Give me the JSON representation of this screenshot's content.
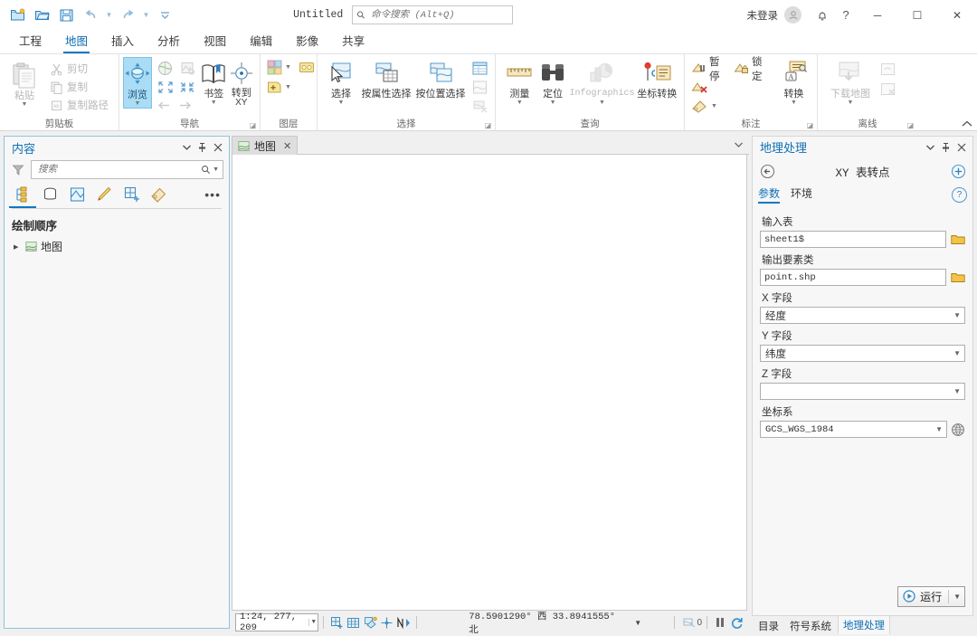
{
  "titlebar": {
    "app_title": "Untitled",
    "search_placeholder": "命令搜索 (Alt+Q)",
    "signin_label": "未登录",
    "qat": [
      {
        "name": "new-project-icon",
        "tooltip": "新建工程"
      },
      {
        "name": "open-project-icon",
        "tooltip": "打开工程"
      },
      {
        "name": "save-project-icon",
        "tooltip": "保存工程"
      },
      {
        "name": "undo-icon",
        "tooltip": "撤销"
      },
      {
        "name": "redo-icon",
        "tooltip": "重做"
      },
      {
        "name": "customize-qat-icon",
        "tooltip": "自定义快速访问工具栏"
      }
    ],
    "window_buttons": {
      "minimize": "─",
      "maximize": "☐",
      "close": "✕"
    }
  },
  "ribbon": {
    "tabs": [
      {
        "label": "工程",
        "active": false
      },
      {
        "label": "地图",
        "active": true
      },
      {
        "label": "插入",
        "active": false
      },
      {
        "label": "分析",
        "active": false
      },
      {
        "label": "视图",
        "active": false
      },
      {
        "label": "编辑",
        "active": false
      },
      {
        "label": "影像",
        "active": false
      },
      {
        "label": "共享",
        "active": false
      }
    ],
    "groups": [
      {
        "label": "剪贴板",
        "big": [
          {
            "label": "粘贴",
            "icon": "paste-icon",
            "dropdown": true
          }
        ],
        "small": [
          {
            "label": "剪切",
            "icon": "cut-icon",
            "disabled": true
          },
          {
            "label": "复制",
            "icon": "copy-icon",
            "disabled": true
          },
          {
            "label": "复制路径",
            "icon": "copy-path-icon",
            "disabled": true
          }
        ]
      },
      {
        "label": "导航",
        "big": [
          {
            "label": "浏览",
            "icon": "explore-icon",
            "selected": true,
            "dropdown": true
          },
          {
            "label": "书签",
            "icon": "bookmarks-icon",
            "dropdown": true
          },
          {
            "label": "转到",
            "label2": "XY",
            "icon": "goto-xy-icon"
          }
        ],
        "mini": [
          {
            "icon": "full-extent-icon"
          },
          {
            "icon": "fixed-zoom-in-icon"
          },
          {
            "icon": "fixed-zoom-out-icon"
          },
          {
            "icon": "previous-extent-icon"
          },
          {
            "icon": "next-extent-icon"
          }
        ],
        "dialog_launcher": true
      },
      {
        "label": "图层",
        "small": [
          {
            "icon": "basemap-icon",
            "dropdown": true
          },
          {
            "icon": "add-preset-icon"
          },
          {
            "icon": "add-data-icon",
            "dropdown": true
          }
        ]
      },
      {
        "label": "选择",
        "big": [
          {
            "label": "选择",
            "icon": "select-icon",
            "dropdown": true
          },
          {
            "label": "按属性选择",
            "icon": "select-by-attributes-icon"
          },
          {
            "label": "按位置选择",
            "icon": "select-by-location-icon"
          }
        ],
        "mini": [
          {
            "icon": "attribute-table-icon"
          },
          {
            "icon": "zoom-to-selection-icon",
            "disabled": true
          },
          {
            "icon": "clear-selection-icon",
            "disabled": true
          }
        ],
        "dialog_launcher": true
      },
      {
        "label": "查询",
        "big": [
          {
            "label": "测量",
            "icon": "measure-icon",
            "dropdown": true
          },
          {
            "label": "定位",
            "icon": "locate-icon",
            "dropdown": true
          },
          {
            "label": "Infographics",
            "icon": "infographics-icon",
            "dropdown": true,
            "disabled": true
          },
          {
            "label": "坐标转换",
            "icon": "convert-coordinates-icon"
          }
        ]
      },
      {
        "label": "标注",
        "small": [
          {
            "label": "暂停",
            "icon": "pause-labeling-icon"
          },
          {
            "label": "锁定",
            "icon": "lock-labeling-icon"
          },
          {
            "icon": "clear-labeling-icon"
          },
          {
            "icon": "label-icon",
            "dropdown": true
          }
        ],
        "big": [
          {
            "label": "转换",
            "icon": "convert-labels-icon",
            "dropdown": true
          }
        ],
        "dialog_launcher": true
      },
      {
        "label": "离线",
        "big": [
          {
            "label": "下载地图",
            "icon": "download-map-icon",
            "dropdown": true,
            "disabled": true
          }
        ],
        "mini": [
          {
            "icon": "sync-icon",
            "disabled": true
          },
          {
            "icon": "manage-replica-icon",
            "disabled": true
          }
        ],
        "dialog_launcher": true
      }
    ]
  },
  "contents": {
    "title": "内容",
    "search_placeholder": "搜索",
    "tabs": [
      {
        "name": "drawing-order-tab",
        "icon": "drawing-order-icon",
        "active": true
      },
      {
        "name": "data-source-tab",
        "icon": "data-source-icon",
        "active": false
      },
      {
        "name": "selection-tab",
        "icon": "selection-icon",
        "active": false
      },
      {
        "name": "editing-tab",
        "icon": "editing-icon",
        "active": false
      },
      {
        "name": "snapping-tab",
        "icon": "snapping-icon",
        "active": false
      },
      {
        "name": "labeling-tab",
        "icon": "labeling-icon",
        "active": false
      }
    ],
    "section_title": "绘制顺序",
    "items": [
      {
        "label": "地图",
        "icon": "map-icon",
        "expanded": true,
        "checked": true
      }
    ]
  },
  "mapview": {
    "tabs": [
      {
        "label": "地图",
        "icon": "map-icon",
        "active": true,
        "close": "✕"
      }
    ]
  },
  "status": {
    "scale": "1:24, 277, 209",
    "coordinates": "78.5901290° 西 33.8941555° 北",
    "selected_count": "0",
    "icons": [
      {
        "name": "grid-snap-icon"
      },
      {
        "name": "grid-icon"
      },
      {
        "name": "selection-tools-icon"
      },
      {
        "name": "crosshair-icon"
      },
      {
        "name": "north-arrow-icon"
      },
      {
        "name": "selection-count-icon"
      },
      {
        "name": "pause-drawing-icon"
      },
      {
        "name": "refresh-icon"
      }
    ]
  },
  "geoprocessing": {
    "title": "地理处理",
    "tool_name": "XY 表转点",
    "tabs": [
      {
        "label": "参数",
        "active": true
      },
      {
        "label": "环境",
        "active": false
      }
    ],
    "fields": [
      {
        "label": "输入表",
        "type": "text",
        "value": "sheet1$",
        "browse": true
      },
      {
        "label": "输出要素类",
        "type": "text",
        "value": "point.shp",
        "browse": true
      },
      {
        "label": "X 字段",
        "type": "combo",
        "value": "经度"
      },
      {
        "label": "Y 字段",
        "type": "combo",
        "value": "纬度"
      },
      {
        "label": "Z 字段",
        "type": "combo",
        "value": ""
      },
      {
        "label": "坐标系",
        "type": "combo-mono",
        "value": "GCS_WGS_1984",
        "globe": true
      }
    ],
    "run_label": "运行"
  },
  "dock_tabs": [
    {
      "label": "目录",
      "active": false
    },
    {
      "label": "符号系统",
      "active": false
    },
    {
      "label": "地理处理",
      "active": true
    }
  ],
  "colors": {
    "accent": "#0b78c4",
    "panel_title": "#0f6fb4",
    "selected_button": "#aadcf5",
    "ribbon_bg": "#ffffff",
    "app_bg": "#f0f0f0"
  }
}
